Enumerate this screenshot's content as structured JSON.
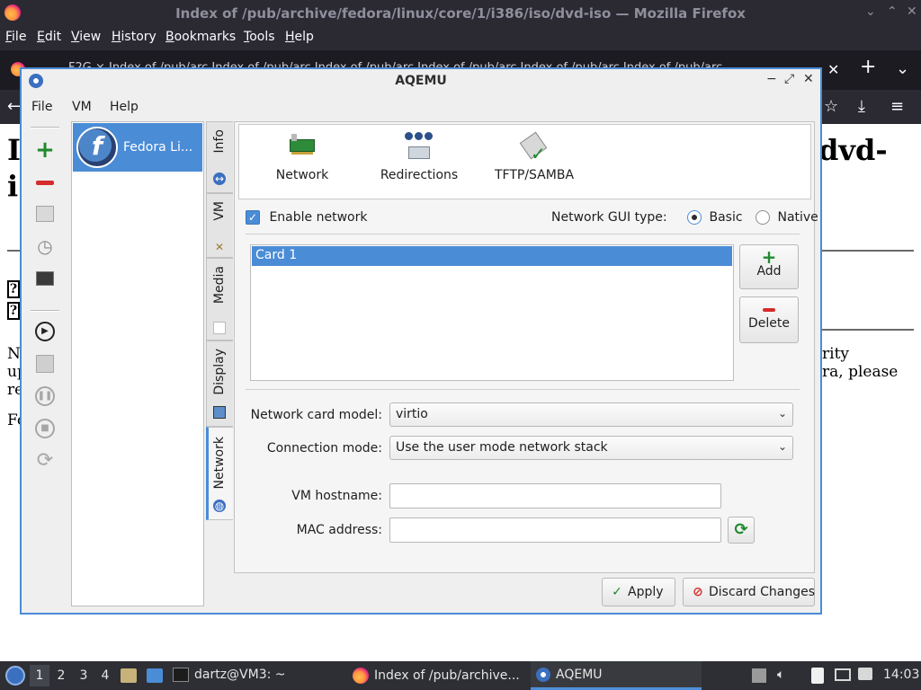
{
  "firefox": {
    "window_title": "Index of /pub/archive/fedora/linux/core/1/i386/iso/dvd-iso — Mozilla Firefox",
    "window_controls": [
      "⌄",
      "⌃",
      "✕"
    ],
    "menu": [
      "File",
      "Edit",
      "View",
      "History",
      "Bookmarks",
      "Tools",
      "Help"
    ],
    "tabs_text": "F2G     ×   Index of /pub/arc    Index of /pub/arc    Index of /pub/arc    Index of /pub/arc    Index of /pub/arc    Index of /pub/arc",
    "tab_buttons": {
      "close": "✕",
      "new_tab": "+",
      "list_all": "⌄"
    },
    "toolbar_buttons": {
      "back": "←",
      "bookmark": "☆",
      "downloads": "⤓",
      "menu": "≡"
    },
    "page": {
      "heading_left": "I",
      "heading_left2": "i",
      "heading_right": "dvd-",
      "text_n": "N",
      "text_up": "up",
      "text_re": "re",
      "text_fo": "Fo",
      "text_rity": "rity",
      "text_ra_please": "ra, please"
    }
  },
  "aqemu": {
    "title": "AQEMU",
    "window_controls": [
      "−",
      "⤢",
      "✕"
    ],
    "menu": [
      "File",
      "VM",
      "Help"
    ],
    "vm_list": [
      {
        "label": "Fedora Li..."
      }
    ],
    "side_tabs": [
      {
        "label": "Info",
        "icon": "info-icon"
      },
      {
        "label": "VM",
        "icon": "tools-icon"
      },
      {
        "label": "Media",
        "icon": "media-icon"
      },
      {
        "label": "Display",
        "icon": "display-icon"
      },
      {
        "label": "Network",
        "icon": "network-globe-icon"
      }
    ],
    "icon_bar": [
      {
        "label": "Network",
        "icon": "network-card-icon"
      },
      {
        "label": "Redirections",
        "icon": "redirections-icon"
      },
      {
        "label": "TFTP/SAMBA",
        "icon": "tftp-samba-icon"
      }
    ],
    "enable_network": {
      "label": "Enable network",
      "checked": true
    },
    "gui_type": {
      "label": "Network GUI type:",
      "options": [
        "Basic",
        "Native"
      ],
      "selected": "Basic"
    },
    "cards": [
      "Card 1"
    ],
    "add_button": "Add",
    "delete_button": "Delete",
    "fields": {
      "card_model": {
        "label": "Network card model:",
        "value": "virtio"
      },
      "connection_mode": {
        "label": "Connection mode:",
        "value": "Use the user mode network stack"
      },
      "vm_hostname": {
        "label": "VM hostname:",
        "value": ""
      },
      "mac_address": {
        "label": "MAC address:",
        "value": ""
      }
    },
    "apply_button": "Apply",
    "discard_button": "Discard Changes"
  },
  "taskbar": {
    "workspaces": [
      "1",
      "2",
      "3",
      "4"
    ],
    "active_workspace": "1",
    "tasks": [
      {
        "label": "dartz@VM3: ~",
        "icon": "terminal-icon"
      },
      {
        "label": "Index of /pub/archive...",
        "icon": "firefox-icon"
      },
      {
        "label": "AQEMU",
        "icon": "aqemu-icon"
      }
    ],
    "clock": "14:03"
  },
  "colors": {
    "accent": "#4a8cd6",
    "add_green": "#1f8a2e",
    "delete_red": "#d62b2b"
  }
}
